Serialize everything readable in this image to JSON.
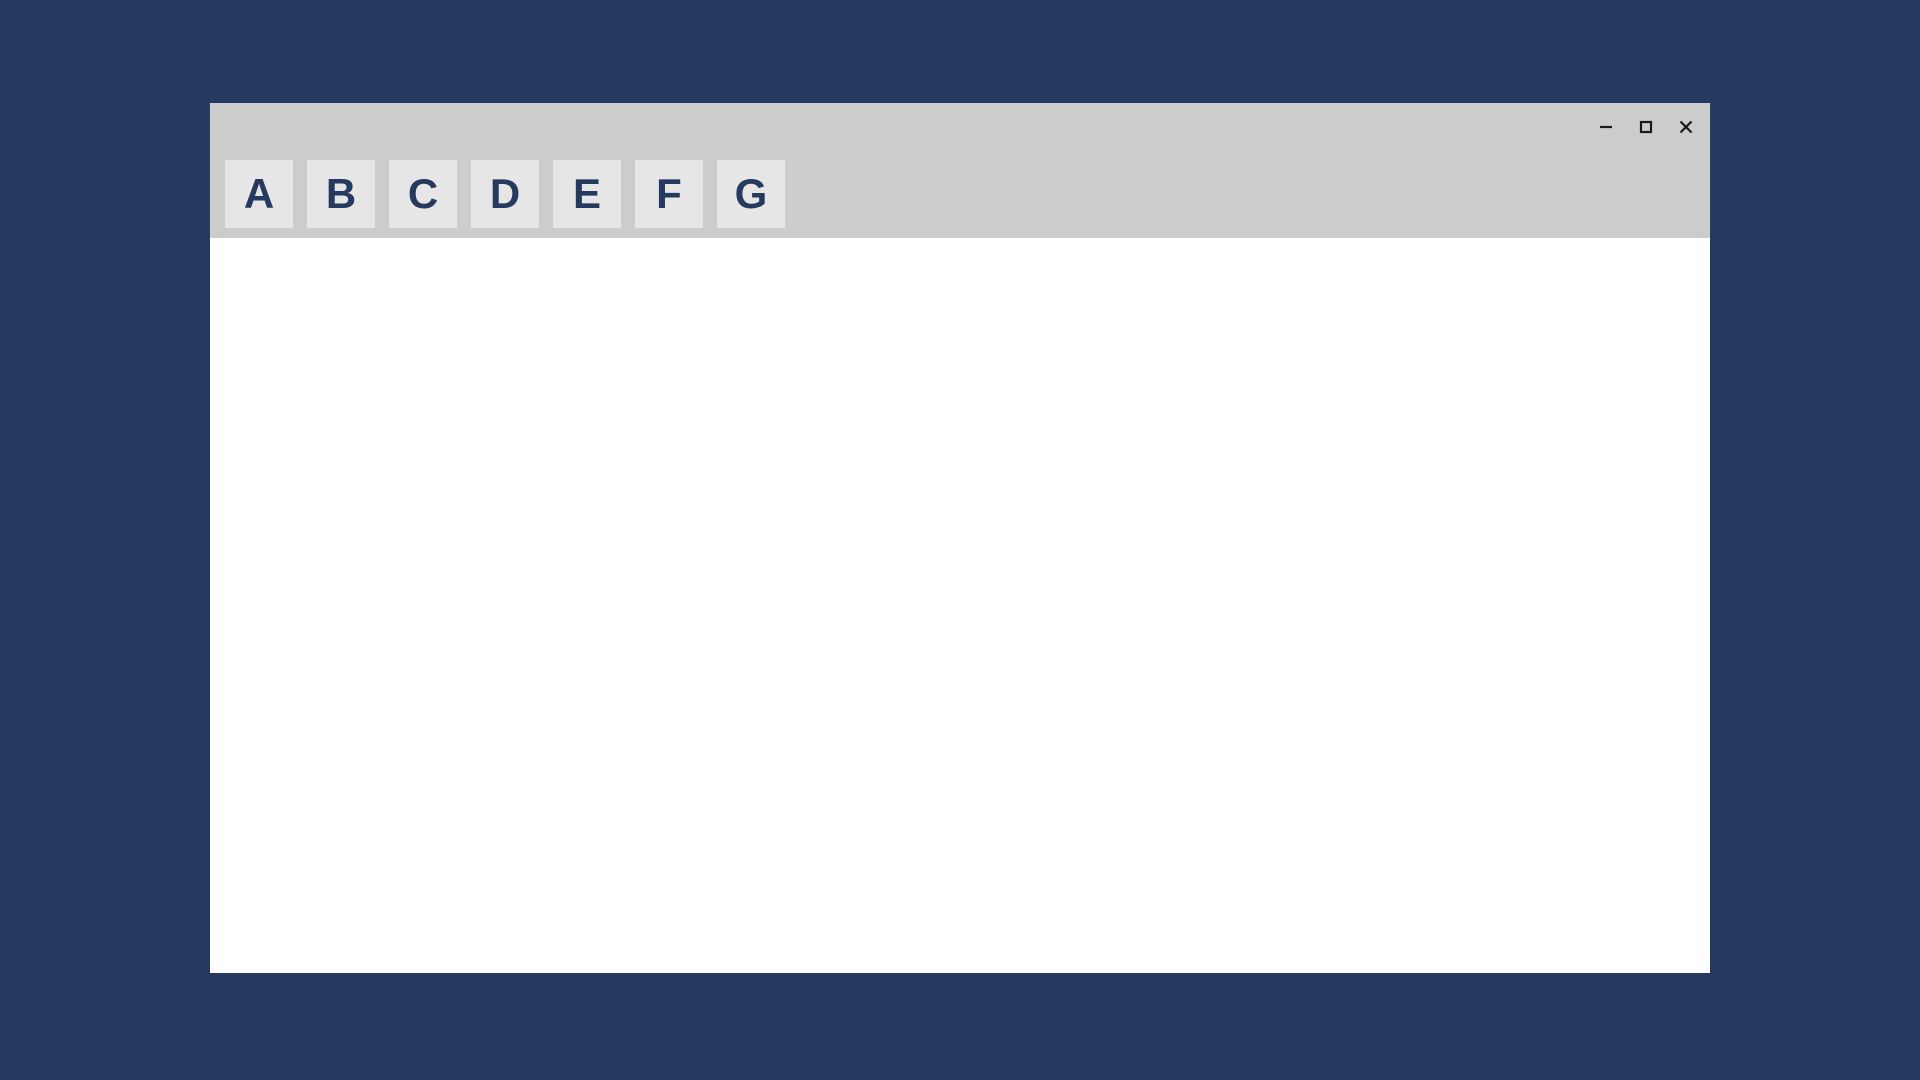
{
  "toolbar": {
    "buttons": [
      {
        "label": "A"
      },
      {
        "label": "B"
      },
      {
        "label": "C"
      },
      {
        "label": "D"
      },
      {
        "label": "E"
      },
      {
        "label": "F"
      },
      {
        "label": "G"
      }
    ]
  },
  "colors": {
    "background": "#253a5e",
    "titlebar": "#cccccc",
    "button_bg": "#e6e6e6",
    "button_fg": "#253a5e",
    "content_bg": "#ffffff"
  }
}
